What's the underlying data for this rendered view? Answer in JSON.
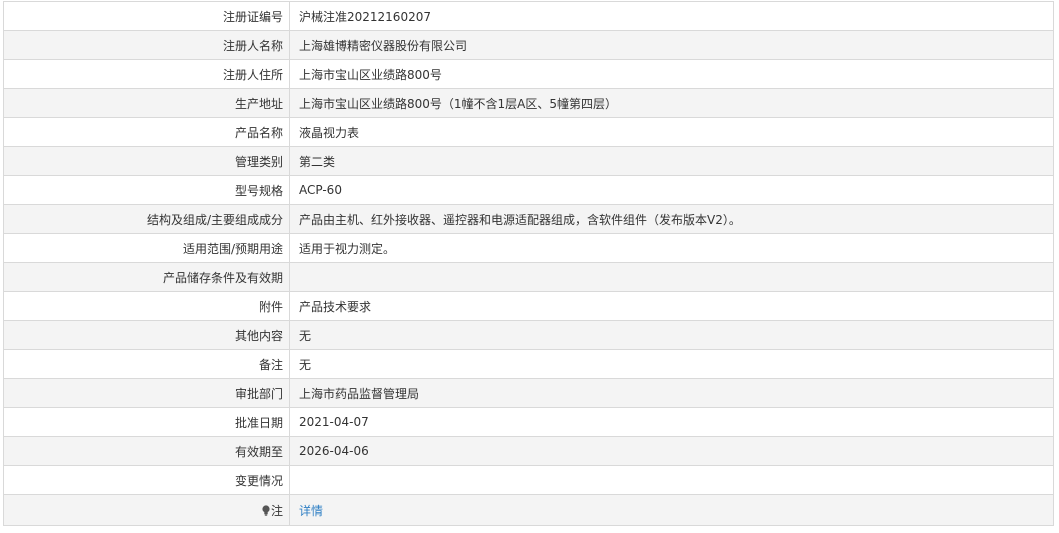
{
  "rows": [
    {
      "label": "注册证编号",
      "value": "沪械注准20212160207"
    },
    {
      "label": "注册人名称",
      "value": "上海雄博精密仪器股份有限公司"
    },
    {
      "label": "注册人住所",
      "value": "上海市宝山区业绩路800号"
    },
    {
      "label": "生产地址",
      "value": "上海市宝山区业绩路800号（1幢不含1层A区、5幢第四层）"
    },
    {
      "label": "产品名称",
      "value": "液晶视力表"
    },
    {
      "label": "管理类别",
      "value": "第二类"
    },
    {
      "label": "型号规格",
      "value": "ACP-60"
    },
    {
      "label": "结构及组成/主要组成成分",
      "value": "产品由主机、红外接收器、遥控器和电源适配器组成，含软件组件（发布版本V2）。"
    },
    {
      "label": "适用范围/预期用途",
      "value": "适用于视力测定。"
    },
    {
      "label": "产品储存条件及有效期",
      "value": ""
    },
    {
      "label": "附件",
      "value": "产品技术要求"
    },
    {
      "label": "其他内容",
      "value": "无"
    },
    {
      "label": "备注",
      "value": "无"
    },
    {
      "label": "审批部门",
      "value": "上海市药品监督管理局"
    },
    {
      "label": "批准日期",
      "value": "2021-04-07"
    },
    {
      "label": "有效期至",
      "value": "2026-04-06"
    },
    {
      "label": "变更情况",
      "value": ""
    }
  ],
  "note": {
    "icon": "lightbulb-icon",
    "label": "注",
    "link_text": "详情",
    "link_color": "#2f7fc4"
  }
}
